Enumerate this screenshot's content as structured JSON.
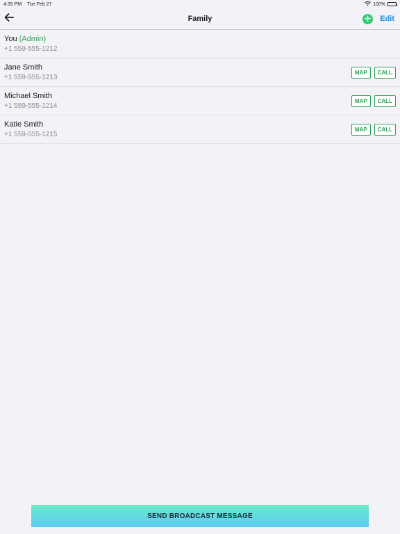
{
  "status_bar": {
    "time": "4:35 PM",
    "date": "Tue Feb 27",
    "battery": "100%",
    "battery_level": 1.0
  },
  "nav": {
    "title": "Family",
    "back_icon": "arrow-left-icon",
    "add_icon": "plus-circle-icon",
    "edit_label": "Edit"
  },
  "members": [
    {
      "name": "You",
      "role": "(Admin)",
      "phone": "+1 559-555-1212"
    },
    {
      "name": "Jane Smith",
      "phone": "+1 559-555-1213",
      "map_label": "MAP",
      "call_label": "CALL"
    },
    {
      "name": "Michael Smith",
      "phone": "+1 559-555-1214",
      "map_label": "MAP",
      "call_label": "CALL"
    },
    {
      "name": "Katie Smith",
      "phone": "+1 559-555-1215",
      "map_label": "MAP",
      "call_label": "CALL"
    }
  ],
  "broadcast_label": "SEND BROADCAST MESSAGE",
  "colors": {
    "accent_green": "#2fa05a",
    "add_green": "#2ecc71",
    "edit_blue": "#1a8fd8",
    "gradient_top": "#6ee8c8",
    "gradient_bottom": "#5cc8f0"
  }
}
